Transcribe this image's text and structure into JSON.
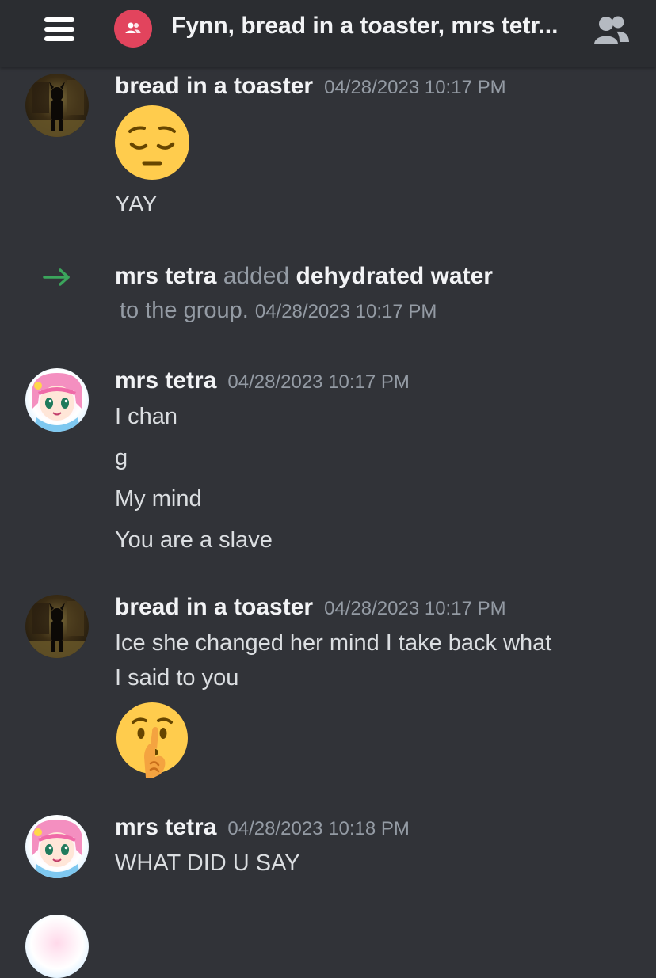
{
  "header": {
    "menu_icon": "hamburger-icon",
    "group_icon": "group-dm-icon",
    "title": "Fynn, bread in a toaster, mrs tetr...",
    "members_icon": "members-icon"
  },
  "colors": {
    "background": "#313338",
    "header": "#2b2d31",
    "group_badge": "#e2445d",
    "system_arrow": "#3ba55c",
    "timestamp": "#949ba4"
  },
  "messages": [
    {
      "author": "bread in a toaster",
      "timestamp": "04/28/2023 10:17 PM",
      "emoji": "pensive-face-emoji",
      "lines": [
        "YAY"
      ]
    },
    {
      "author": "mrs tetra",
      "timestamp": "04/28/2023 10:17 PM",
      "lines": [
        "I chan",
        "g",
        "My mind",
        "You are a slave"
      ]
    },
    {
      "author": "bread in a toaster",
      "timestamp": "04/28/2023 10:17 PM",
      "lines": [
        "Ice she changed her mind I take back what",
        "I said to you"
      ],
      "emoji": "shushing-face-emoji"
    },
    {
      "author": "mrs tetra",
      "timestamp": "04/28/2023 10:18 PM",
      "lines": [
        "WHAT DID U SAY"
      ]
    }
  ],
  "system": {
    "icon": "join-arrow-icon",
    "actor": "mrs tetra",
    "verb": "added",
    "target": "dehydrated water",
    "suffix": "to the group.",
    "timestamp": "04/28/2023 10:17 PM"
  }
}
